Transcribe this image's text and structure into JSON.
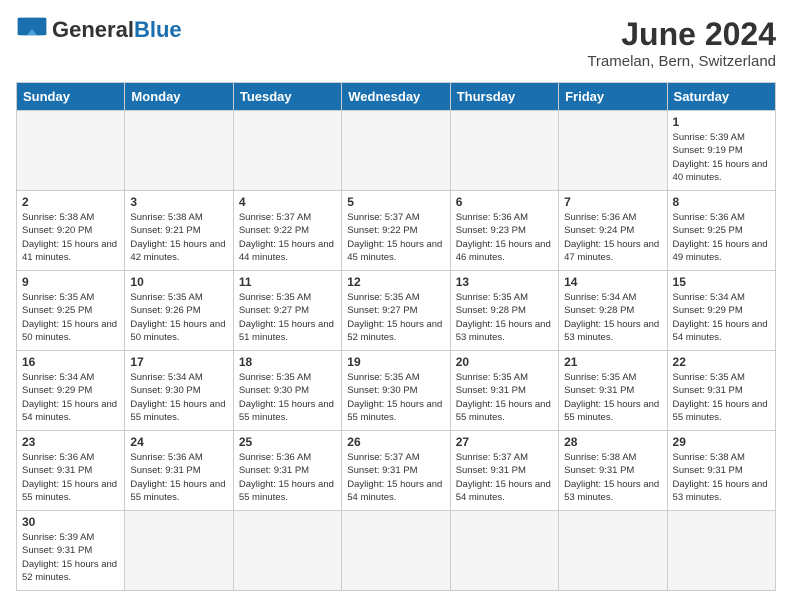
{
  "header": {
    "logo_general": "General",
    "logo_blue": "Blue",
    "month_year": "June 2024",
    "location": "Tramelan, Bern, Switzerland"
  },
  "days_of_week": [
    "Sunday",
    "Monday",
    "Tuesday",
    "Wednesday",
    "Thursday",
    "Friday",
    "Saturday"
  ],
  "weeks": [
    [
      {
        "day": "",
        "info": ""
      },
      {
        "day": "",
        "info": ""
      },
      {
        "day": "",
        "info": ""
      },
      {
        "day": "",
        "info": ""
      },
      {
        "day": "",
        "info": ""
      },
      {
        "day": "",
        "info": ""
      },
      {
        "day": "1",
        "info": "Sunrise: 5:39 AM\nSunset: 9:19 PM\nDaylight: 15 hours and 40 minutes."
      }
    ],
    [
      {
        "day": "2",
        "info": "Sunrise: 5:38 AM\nSunset: 9:20 PM\nDaylight: 15 hours and 41 minutes."
      },
      {
        "day": "3",
        "info": "Sunrise: 5:38 AM\nSunset: 9:21 PM\nDaylight: 15 hours and 42 minutes."
      },
      {
        "day": "4",
        "info": "Sunrise: 5:37 AM\nSunset: 9:22 PM\nDaylight: 15 hours and 44 minutes."
      },
      {
        "day": "5",
        "info": "Sunrise: 5:37 AM\nSunset: 9:22 PM\nDaylight: 15 hours and 45 minutes."
      },
      {
        "day": "6",
        "info": "Sunrise: 5:36 AM\nSunset: 9:23 PM\nDaylight: 15 hours and 46 minutes."
      },
      {
        "day": "7",
        "info": "Sunrise: 5:36 AM\nSunset: 9:24 PM\nDaylight: 15 hours and 47 minutes."
      },
      {
        "day": "8",
        "info": "Sunrise: 5:36 AM\nSunset: 9:25 PM\nDaylight: 15 hours and 49 minutes."
      }
    ],
    [
      {
        "day": "9",
        "info": "Sunrise: 5:35 AM\nSunset: 9:25 PM\nDaylight: 15 hours and 50 minutes."
      },
      {
        "day": "10",
        "info": "Sunrise: 5:35 AM\nSunset: 9:26 PM\nDaylight: 15 hours and 50 minutes."
      },
      {
        "day": "11",
        "info": "Sunrise: 5:35 AM\nSunset: 9:27 PM\nDaylight: 15 hours and 51 minutes."
      },
      {
        "day": "12",
        "info": "Sunrise: 5:35 AM\nSunset: 9:27 PM\nDaylight: 15 hours and 52 minutes."
      },
      {
        "day": "13",
        "info": "Sunrise: 5:35 AM\nSunset: 9:28 PM\nDaylight: 15 hours and 53 minutes."
      },
      {
        "day": "14",
        "info": "Sunrise: 5:34 AM\nSunset: 9:28 PM\nDaylight: 15 hours and 53 minutes."
      },
      {
        "day": "15",
        "info": "Sunrise: 5:34 AM\nSunset: 9:29 PM\nDaylight: 15 hours and 54 minutes."
      }
    ],
    [
      {
        "day": "16",
        "info": "Sunrise: 5:34 AM\nSunset: 9:29 PM\nDaylight: 15 hours and 54 minutes."
      },
      {
        "day": "17",
        "info": "Sunrise: 5:34 AM\nSunset: 9:30 PM\nDaylight: 15 hours and 55 minutes."
      },
      {
        "day": "18",
        "info": "Sunrise: 5:35 AM\nSunset: 9:30 PM\nDaylight: 15 hours and 55 minutes."
      },
      {
        "day": "19",
        "info": "Sunrise: 5:35 AM\nSunset: 9:30 PM\nDaylight: 15 hours and 55 minutes."
      },
      {
        "day": "20",
        "info": "Sunrise: 5:35 AM\nSunset: 9:31 PM\nDaylight: 15 hours and 55 minutes."
      },
      {
        "day": "21",
        "info": "Sunrise: 5:35 AM\nSunset: 9:31 PM\nDaylight: 15 hours and 55 minutes."
      },
      {
        "day": "22",
        "info": "Sunrise: 5:35 AM\nSunset: 9:31 PM\nDaylight: 15 hours and 55 minutes."
      }
    ],
    [
      {
        "day": "23",
        "info": "Sunrise: 5:36 AM\nSunset: 9:31 PM\nDaylight: 15 hours and 55 minutes."
      },
      {
        "day": "24",
        "info": "Sunrise: 5:36 AM\nSunset: 9:31 PM\nDaylight: 15 hours and 55 minutes."
      },
      {
        "day": "25",
        "info": "Sunrise: 5:36 AM\nSunset: 9:31 PM\nDaylight: 15 hours and 55 minutes."
      },
      {
        "day": "26",
        "info": "Sunrise: 5:37 AM\nSunset: 9:31 PM\nDaylight: 15 hours and 54 minutes."
      },
      {
        "day": "27",
        "info": "Sunrise: 5:37 AM\nSunset: 9:31 PM\nDaylight: 15 hours and 54 minutes."
      },
      {
        "day": "28",
        "info": "Sunrise: 5:38 AM\nSunset: 9:31 PM\nDaylight: 15 hours and 53 minutes."
      },
      {
        "day": "29",
        "info": "Sunrise: 5:38 AM\nSunset: 9:31 PM\nDaylight: 15 hours and 53 minutes."
      }
    ],
    [
      {
        "day": "30",
        "info": "Sunrise: 5:39 AM\nSunset: 9:31 PM\nDaylight: 15 hours and 52 minutes."
      },
      {
        "day": "",
        "info": ""
      },
      {
        "day": "",
        "info": ""
      },
      {
        "day": "",
        "info": ""
      },
      {
        "day": "",
        "info": ""
      },
      {
        "day": "",
        "info": ""
      },
      {
        "day": "",
        "info": ""
      }
    ]
  ]
}
